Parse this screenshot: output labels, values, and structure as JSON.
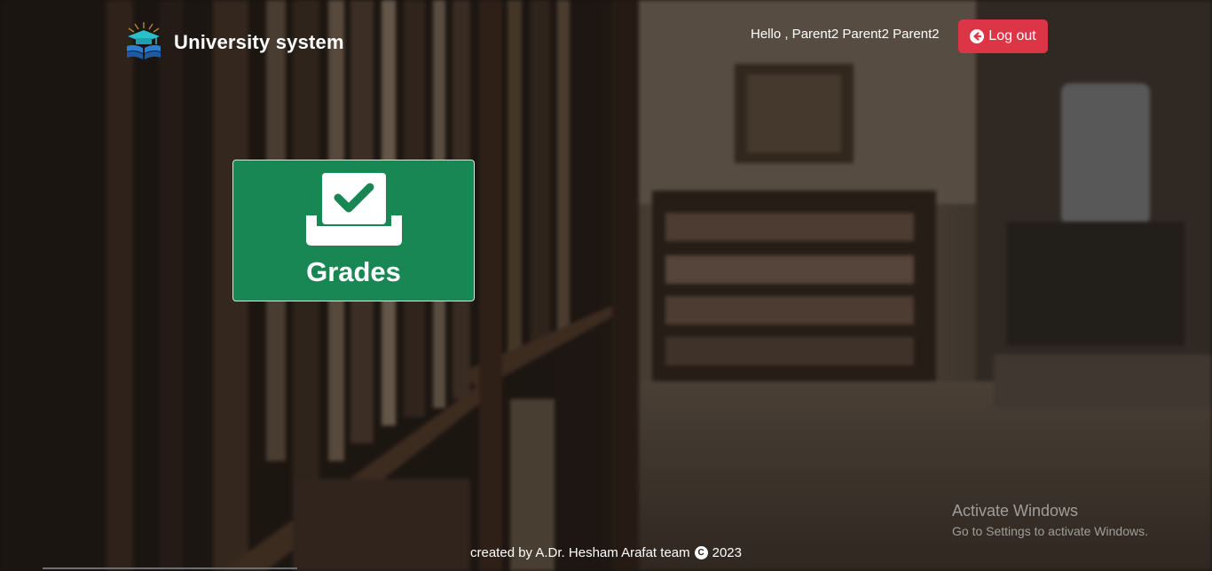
{
  "header": {
    "brand_title": "University system",
    "greeting": "Hello , Parent2 Parent2 Parent2",
    "logout_label": "Log out"
  },
  "main": {
    "cards": [
      {
        "label": "Grades",
        "icon": "inbox-check-icon"
      }
    ]
  },
  "watermark": {
    "title": "Activate Windows",
    "subtitle": "Go to Settings to activate Windows."
  },
  "footer": {
    "credit": "created by A.Dr. Hesham Arafat team",
    "copyright_symbol": "C",
    "year": "2023"
  },
  "colors": {
    "card_green": "#198754",
    "logout_red": "#dc3545",
    "text_white": "#ffffff"
  }
}
